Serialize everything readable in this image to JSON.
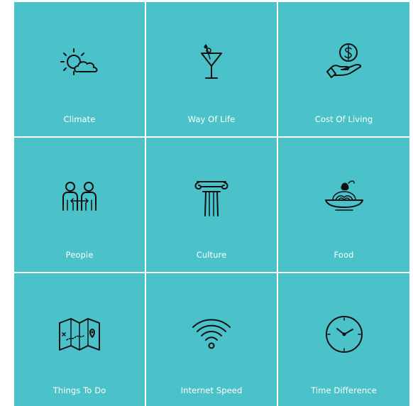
{
  "theme": {
    "tile_color": "#4bc2ca",
    "label_color": "#ffffff",
    "icon_color": "#111111"
  },
  "tiles": [
    {
      "label": "Climate",
      "icon": "sun-cloud-icon"
    },
    {
      "label": "Way Of Life",
      "icon": "cocktail-glass-icon"
    },
    {
      "label": "Cost Of Living",
      "icon": "hand-dollar-coin-icon"
    },
    {
      "label": "People",
      "icon": "two-people-exchange-icon"
    },
    {
      "label": "Culture",
      "icon": "ionic-column-icon"
    },
    {
      "label": "Food",
      "icon": "pasta-plate-icon"
    },
    {
      "label": "Things To Do",
      "icon": "map-icon"
    },
    {
      "label": "Internet Speed",
      "icon": "wifi-icon"
    },
    {
      "label": "Time Difference",
      "icon": "clock-icon"
    }
  ]
}
